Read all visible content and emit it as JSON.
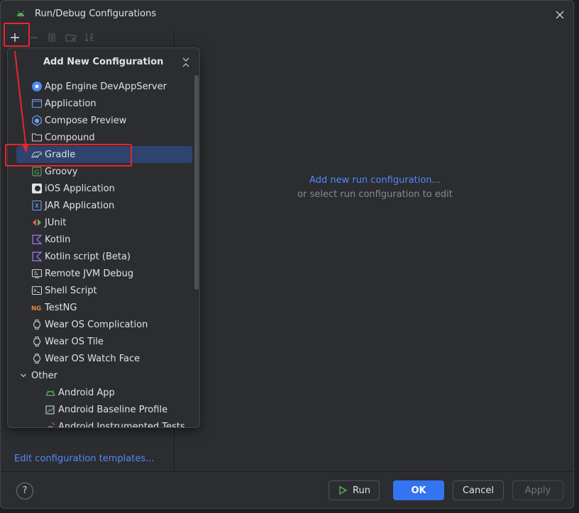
{
  "window": {
    "title": "Run/Debug Configurations"
  },
  "toolbar": {
    "add": "+",
    "remove": "−"
  },
  "popup": {
    "title": "Add New Configuration",
    "items": [
      {
        "label": "App Engine DevAppServer",
        "icon": "appengine-icon"
      },
      {
        "label": "Application",
        "icon": "application-icon"
      },
      {
        "label": "Compose Preview",
        "icon": "compose-icon"
      },
      {
        "label": "Compound",
        "icon": "compound-icon"
      },
      {
        "label": "Gradle",
        "icon": "gradle-icon",
        "selected": true
      },
      {
        "label": "Groovy",
        "icon": "groovy-icon"
      },
      {
        "label": "iOS Application",
        "icon": "ios-icon"
      },
      {
        "label": "JAR Application",
        "icon": "jar-icon"
      },
      {
        "label": "JUnit",
        "icon": "junit-icon"
      },
      {
        "label": "Kotlin",
        "icon": "kotlin-icon"
      },
      {
        "label": "Kotlin script (Beta)",
        "icon": "kotlin-script-icon"
      },
      {
        "label": "Remote JVM Debug",
        "icon": "remote-debug-icon"
      },
      {
        "label": "Shell Script",
        "icon": "shell-icon"
      },
      {
        "label": "TestNG",
        "icon": "testng-icon"
      },
      {
        "label": "Wear OS Complication",
        "icon": "watch-icon"
      },
      {
        "label": "Wear OS Tile",
        "icon": "watch-icon"
      },
      {
        "label": "Wear OS Watch Face",
        "icon": "watch-icon"
      }
    ],
    "group": {
      "label": "Other",
      "icon": "chevron-down-icon"
    },
    "children": [
      {
        "label": "Android App",
        "icon": "android-icon"
      },
      {
        "label": "Android Baseline Profile",
        "icon": "baseline-profile-icon"
      },
      {
        "label": "Android Instrumented Tests",
        "icon": "instrumented-tests-icon"
      }
    ]
  },
  "left": {
    "edit_templates": "Edit configuration templates..."
  },
  "right": {
    "hint_link": "Add new run configuration...",
    "hint_sub": "or select run configuration to edit"
  },
  "buttons": {
    "help": "?",
    "run": "Run",
    "ok": "OK",
    "cancel": "Cancel",
    "apply": "Apply"
  },
  "colors": {
    "accent": "#3574f0",
    "link": "#548af7",
    "selection": "#2e436e",
    "annotation": "#e8262b",
    "android": "#5fb85f"
  }
}
